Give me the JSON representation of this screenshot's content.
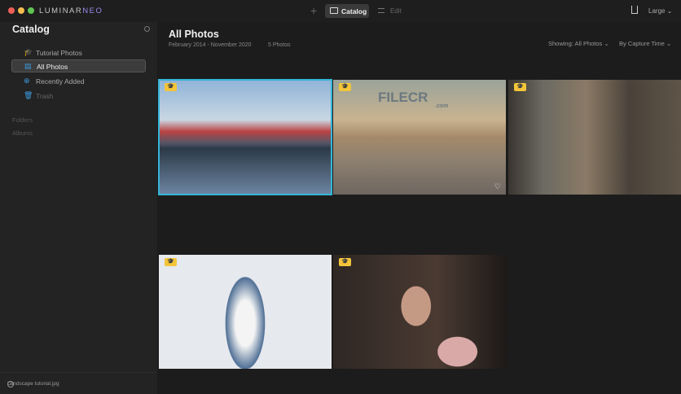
{
  "app": {
    "logo_a": "LUMINAR",
    "logo_b": "NEO",
    "add": "+",
    "tab_catalog": "Catalog",
    "tab_edit": "Edit",
    "size": "Large ⌄"
  },
  "sidebar": {
    "title": "Catalog",
    "items": [
      {
        "label": "Tutorial Photos",
        "icon": "🎓"
      },
      {
        "label": "All Photos",
        "icon": "▤"
      },
      {
        "label": "Recently Added",
        "icon": "⊕"
      },
      {
        "label": "Trash",
        "icon": "🗑"
      }
    ],
    "sections": [
      "Folders",
      "Albums"
    ],
    "footer": "Landscape tutorial.jpg"
  },
  "main": {
    "title": "All Photos",
    "date_range": "February 2014 - November 2020",
    "count": "5 Photos",
    "showing": "Showing: All Photos ⌄",
    "sort": "By Capture Time ⌄"
  },
  "photos": [
    {
      "subject": "harbor-houses",
      "watermark": ""
    },
    {
      "subject": "beach-sunset",
      "watermark": "FILECR"
    },
    {
      "subject": "city-street"
    },
    {
      "subject": "woman-white-top"
    },
    {
      "subject": "woman-portrait"
    }
  ],
  "watermark_sub": ".com",
  "colors": {
    "accent": "#34b6d8",
    "badge": "#f3c53a"
  }
}
